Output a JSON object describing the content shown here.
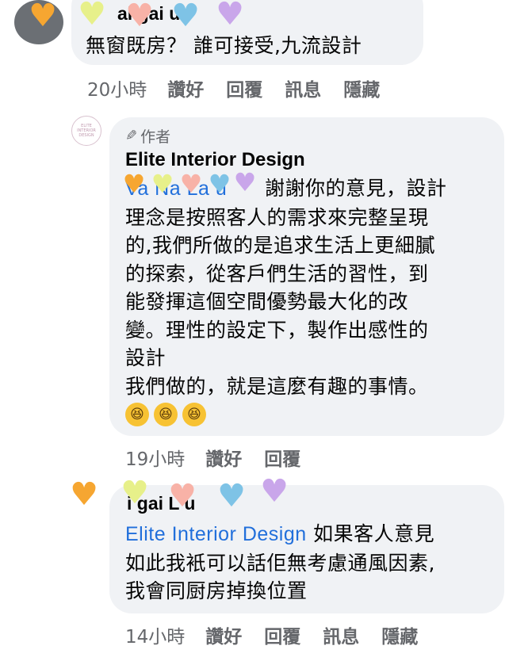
{
  "comments": [
    {
      "author_partial": "ai  gai  u",
      "text": "無窗既房？ 誰可接受,九流設計",
      "time": "20小時",
      "actions": [
        "讚好",
        "回覆",
        "訊息",
        "隱藏"
      ]
    },
    {
      "avatar_text": "ELITE\nINTERIOR\nDESIGN",
      "badge": "作者",
      "author": "Elite Interior Design",
      "mention_partial": "Va  Na  La u",
      "lines": [
        "謝謝你的意見，設計",
        "理念是按照客人的需求來完整呈現",
        "的,我們所做的是追求生活上更細膩",
        "的探索，從客戶們生活的習性，到",
        "能發揮這個空間優勢最大化的改",
        "變。理性的設定下，製作出感性的",
        "設計",
        "我們做的，就是這麼有趣的事情。"
      ],
      "emoji_glyphs": [
        "😆",
        "😆",
        "😆"
      ],
      "time": "19小時",
      "actions": [
        "讚好",
        "回覆"
      ]
    },
    {
      "author_partial": "i  gai  L  u",
      "mention": "Elite Interior Design",
      "lines": [
        "如果客人意見",
        "如此我衹可以話佢無考慮通風因素,",
        "我會同厨房掉換位置"
      ],
      "time": "14小時",
      "actions": [
        "讚好",
        "回覆",
        "訊息",
        "隱藏"
      ]
    }
  ],
  "icons": {
    "pen": "pen-icon",
    "heart_colors": [
      "#f6a631",
      "#e7f08a",
      "#7fd08a",
      "#f8b2a7",
      "#7ec3e6",
      "#c9a6ea",
      "#f2a0bf"
    ]
  }
}
